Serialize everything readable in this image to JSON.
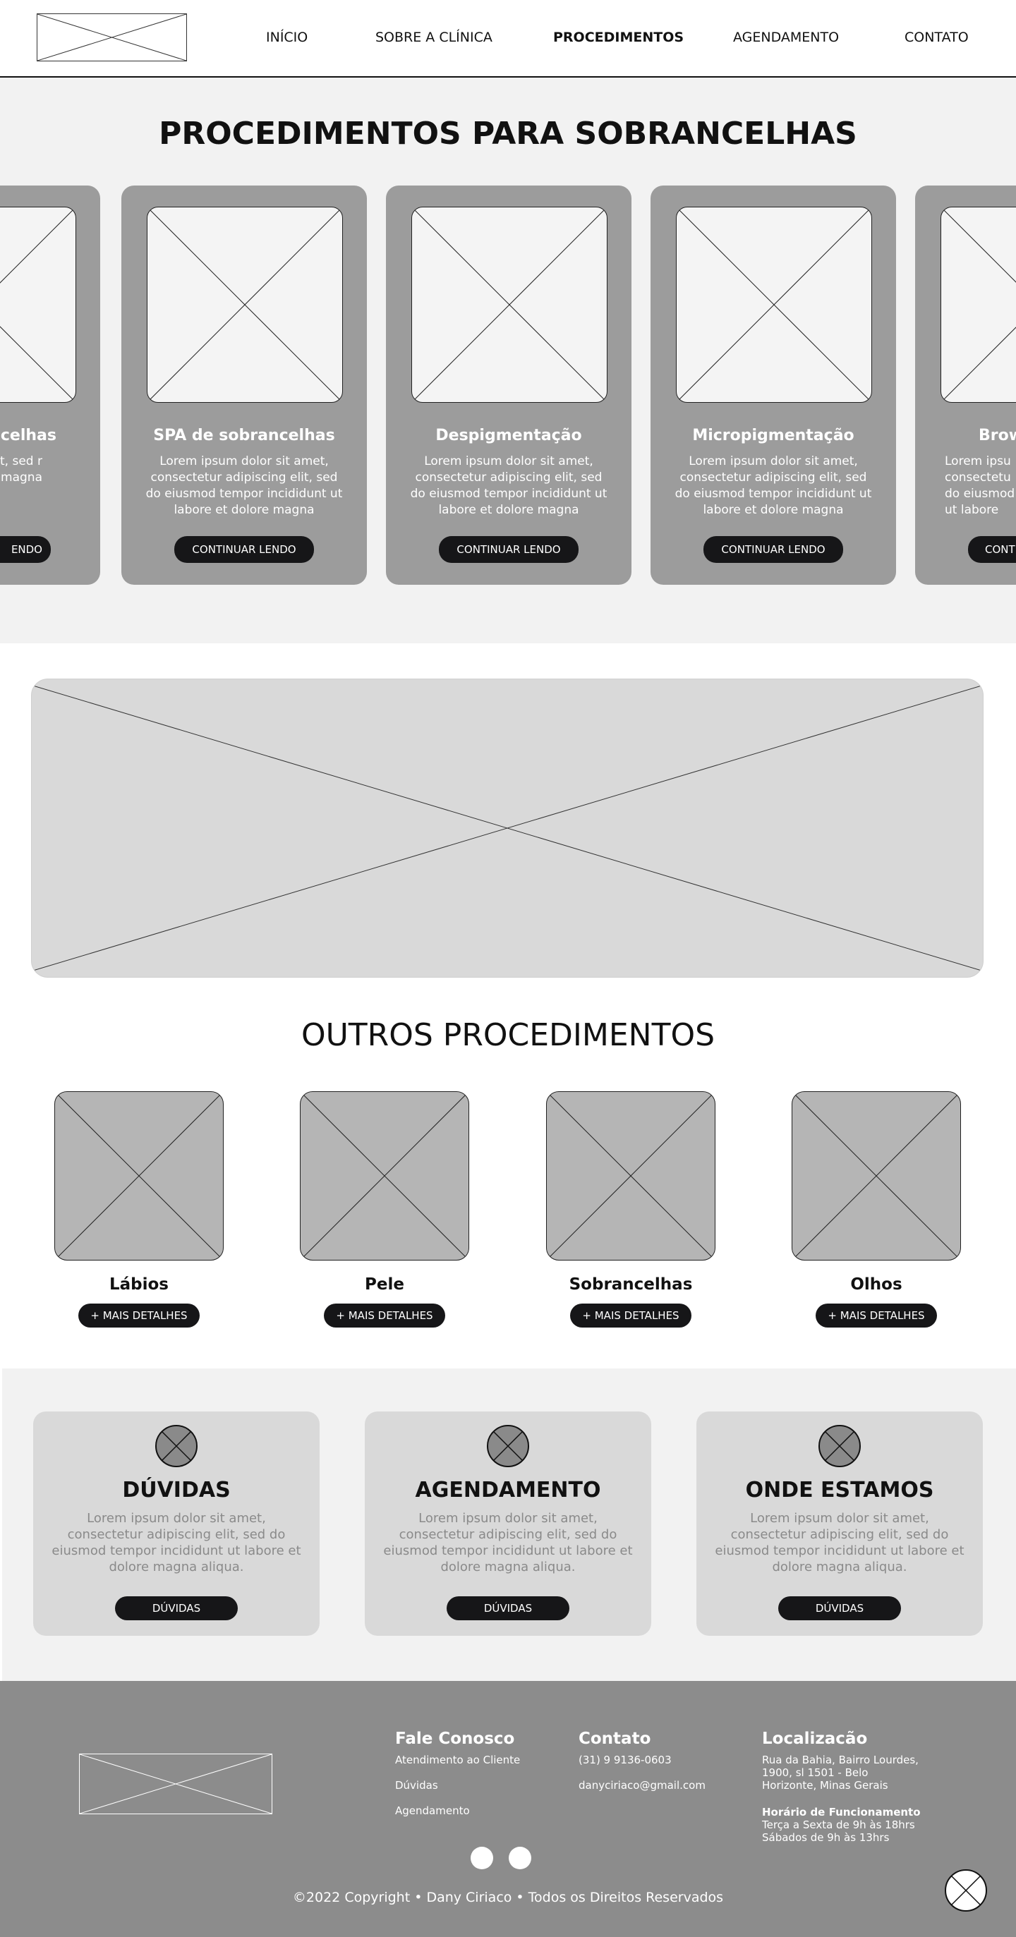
{
  "nav": {
    "items": [
      "INÍCIO",
      "SOBRE A CLÍNICA",
      "PROCEDIMENTOS",
      "AGENDAMENTO",
      "CONTATO"
    ],
    "active": "PROCEDIMENTOS"
  },
  "eyebrow": {
    "title": "PROCEDIMENTOS PARA SOBRANCELHAS",
    "cards": [
      {
        "title": "ncelhas",
        "text": "or sit amet, cing elit, sed r incididunt re magna",
        "button": "ENDO"
      },
      {
        "title": "SPA de sobrancelhas",
        "text": "Lorem ipsum dolor sit amet, consectetur adipiscing elit, sed do eiusmod tempor incididunt ut labore et dolore  magna",
        "button": "CONTINUAR LENDO"
      },
      {
        "title": "Despigmentação",
        "text": "Lorem ipsum dolor sit amet, consectetur adipiscing elit, sed do eiusmod tempor incididunt ut labore et dolore  magna",
        "button": "CONTINUAR LENDO"
      },
      {
        "title": "Micropigmentação",
        "text": "Lorem ipsum dolor sit amet, consectetur adipiscing elit, sed do eiusmod tempor incididunt ut labore et dolore  magna",
        "button": "CONTINUAR LENDO"
      },
      {
        "title": "Brow",
        "text": "Lorem ipsu consectetu do eiusmod ut labore",
        "button": "CONT"
      }
    ]
  },
  "outros": {
    "title": "OUTROS PROCEDIMENTOS",
    "items": [
      {
        "label": "Lábios",
        "button": "+ MAIS DETALHES"
      },
      {
        "label": "Pele",
        "button": "+ MAIS DETALHES"
      },
      {
        "label": "Sobrancelhas",
        "button": "+ MAIS DETALHES"
      },
      {
        "label": "Olhos",
        "button": "+ MAIS DETALHES"
      }
    ]
  },
  "info": {
    "cards": [
      {
        "title": "DÚVIDAS",
        "text": "Lorem ipsum dolor sit amet, consectetur adipiscing elit, sed do eiusmod tempor incididunt ut labore et dolore magna aliqua.",
        "button": "DÚVIDAS"
      },
      {
        "title": "AGENDAMENTO",
        "text": "Lorem ipsum dolor sit amet, consectetur adipiscing elit, sed do eiusmod tempor incididunt ut labore et dolore magna aliqua.",
        "button": "DÚVIDAS"
      },
      {
        "title": "ONDE ESTAMOS",
        "text": "Lorem ipsum dolor sit amet, consectetur adipiscing elit, sed do eiusmod tempor incididunt ut labore et dolore magna aliqua.",
        "button": "DÚVIDAS"
      }
    ]
  },
  "footer": {
    "fale": {
      "title": "Fale Conosco",
      "links": [
        "Atendimento ao Cliente",
        "Dúvidas",
        "Agendamento"
      ]
    },
    "contato": {
      "title": "Contato",
      "phone": "(31) 9 9136-0603",
      "email": "danyciriaco@gmail.com"
    },
    "localizacao": {
      "title": "Localizacão",
      "address": "Rua da Bahia, Bairro Lourdes, 1900, sl 1501  - Belo Horizonte, Minas Gerais",
      "hours_title": "Horário de Funcionamento",
      "hours_weekdays": "Terça a Sexta de 9h às 18hrs",
      "hours_saturday": "Sábados de 9h às 13hrs"
    },
    "copyright": "©2022 Copyright • Dany Ciriaco • Todos os Direitos Reservados"
  },
  "colors": {
    "card_bg": "#9c9c9c",
    "section_bg": "#f2f2f2",
    "button_bg": "#161618",
    "footer_bg": "#8c8c8c",
    "info_card_bg": "#d9d9d9"
  }
}
